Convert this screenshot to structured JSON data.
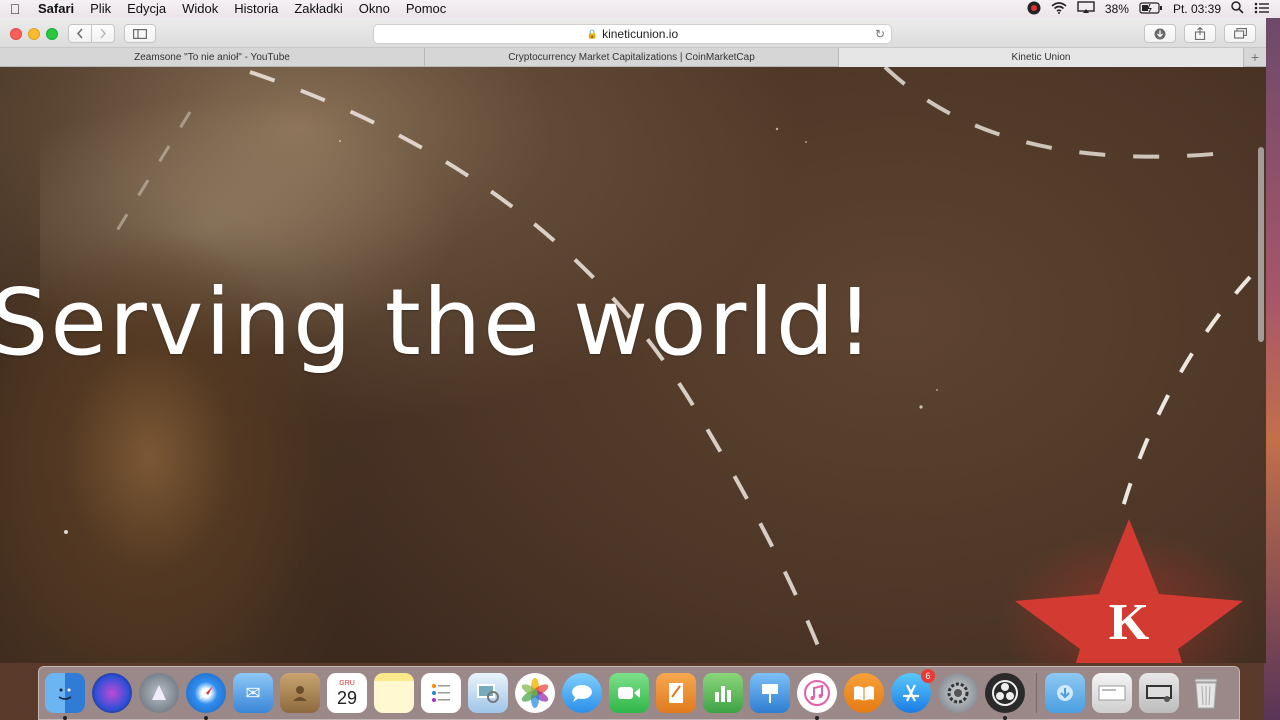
{
  "menubar": {
    "items": [
      "Safari",
      "Plik",
      "Edycja",
      "Widok",
      "Historia",
      "Zakładki",
      "Okno",
      "Pomoc"
    ],
    "battery": "38%",
    "clock": "Pt. 03:39"
  },
  "browser": {
    "url": "kineticunion.io",
    "tabs": [
      {
        "title": "Zeamsone \"To nie anioł\" - YouTube"
      },
      {
        "title": "Cryptocurrency Market Capitalizations | CoinMarketCap"
      },
      {
        "title": "Kinetic Union"
      }
    ],
    "active_tab_index": 2
  },
  "page": {
    "headline": "Serving the world!",
    "logo_letter": "K",
    "logo_color": "#d9362f"
  },
  "dock": {
    "calendar_month": "GRU",
    "calendar_day": "29",
    "app_store_badge": "6",
    "apps": [
      "finder",
      "siri",
      "launchpad",
      "safari",
      "mail",
      "contacts",
      "calendar",
      "notes",
      "reminders",
      "preview",
      "photos",
      "messages",
      "facetime",
      "pages",
      "numbers",
      "keynote",
      "itunes",
      "ibooks",
      "app-store",
      "system-preferences",
      "obs",
      "downloads-folder",
      "documents-stack",
      "screenshots-stack",
      "trash"
    ]
  }
}
